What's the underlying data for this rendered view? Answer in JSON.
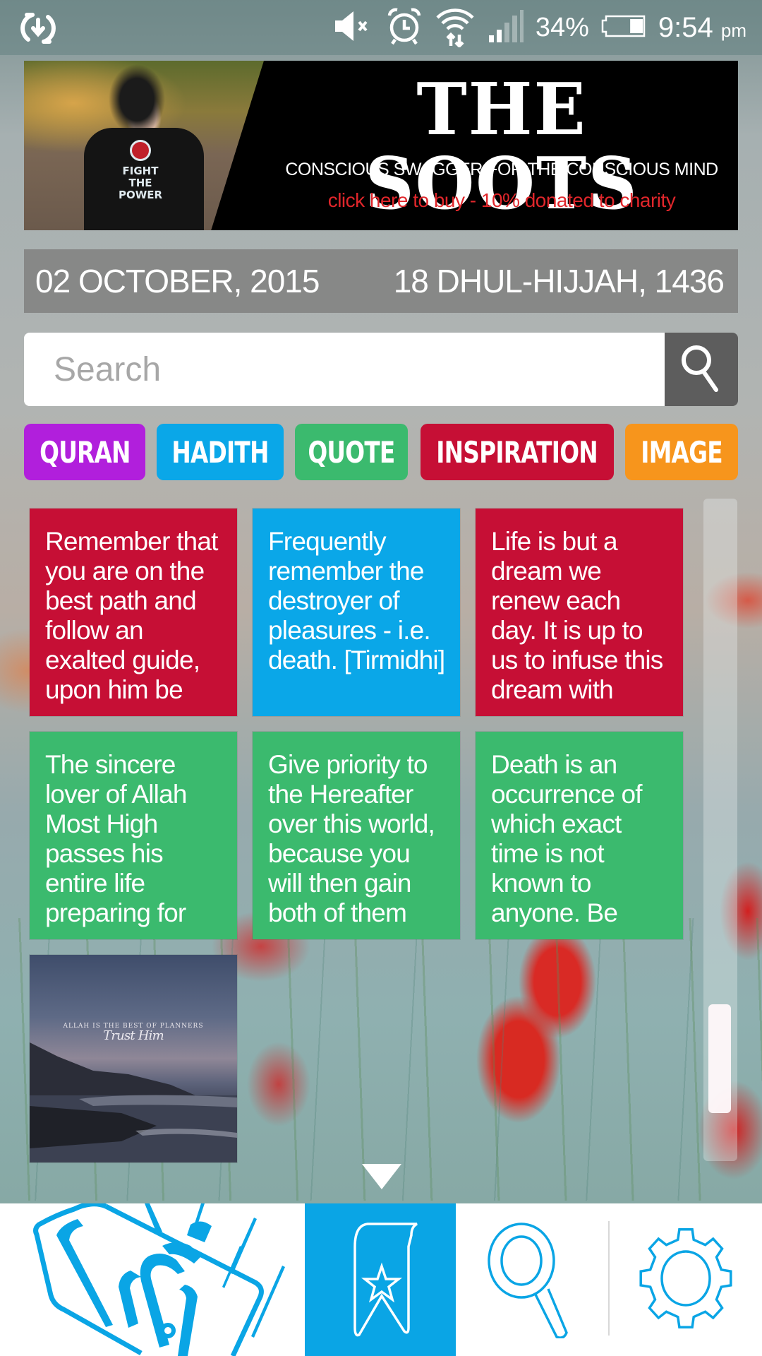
{
  "status_bar": {
    "sync_icon": "sync-icon",
    "mute_icon": "volume-muted-icon",
    "alarm_icon": "alarm-icon",
    "wifi_icon": "wifi-icon",
    "signal_icon": "signal-icon",
    "battery_percent": "34%",
    "battery_level": 0.34,
    "time": "9:54",
    "ampm": "pm"
  },
  "banner": {
    "title": "THE SOOTS",
    "subtitle": "CONSCIOUS SWAGGER FOR THE CONSCIOUS MIND",
    "cta": "click here to buy - 10% donated to charity",
    "shirt_print": "FIGHT THE POWER",
    "cta_color": "#e0262b"
  },
  "date_bar": {
    "gregorian": "02 OCTOBER, 2015",
    "hijri": "18 DHUL-HIJJAH, 1436"
  },
  "search": {
    "placeholder": "Search",
    "value": "",
    "button_icon": "search-icon"
  },
  "categories": [
    {
      "label": "QURAN",
      "color": "#b11fdc"
    },
    {
      "label": "HADITH",
      "color": "#0aa7e8"
    },
    {
      "label": "QUOTE",
      "color": "#3bba6e"
    },
    {
      "label": "INSPIRATION",
      "color": "#c60f35"
    },
    {
      "label": "IMAGE",
      "color": "#f7951c"
    }
  ],
  "cards": [
    {
      "type": "inspiration",
      "color": "#c60f35",
      "text": "Remember that you are on the best path and follow an exalted guide, upon him be"
    },
    {
      "type": "hadith",
      "color": "#0aa7e8",
      "text": "Frequently remember the destroyer of pleasures - i.e. death. [Tirmidhi]"
    },
    {
      "type": "inspiration",
      "color": "#c60f35",
      "text": "Life is but a dream we renew each day. It is up to us to infuse this dream with"
    },
    {
      "type": "quote",
      "color": "#3bba6e",
      "text": "The sincere lover of Allah Most High passes his entire life preparing for"
    },
    {
      "type": "quote",
      "color": "#3bba6e",
      "text": "Give priority to the Hereafter over this world, because you will then gain both of them"
    },
    {
      "type": "quote",
      "color": "#3bba6e",
      "text": "Death is an occurrence of which exact time is not known to anyone. Be"
    },
    {
      "type": "image",
      "title": "ALLAH IS THE BEST OF PLANNERS",
      "script": "Trust Him"
    }
  ],
  "scroll": {
    "position": 0.92
  },
  "bottom_nav": {
    "logo_text": "أقوال",
    "items": [
      {
        "name": "favorites",
        "icon": "bookmark-star-icon",
        "active": true
      },
      {
        "name": "search",
        "icon": "search-icon",
        "active": false
      },
      {
        "name": "settings",
        "icon": "gear-icon",
        "active": false
      }
    ],
    "accent": "#0aa5e5"
  }
}
